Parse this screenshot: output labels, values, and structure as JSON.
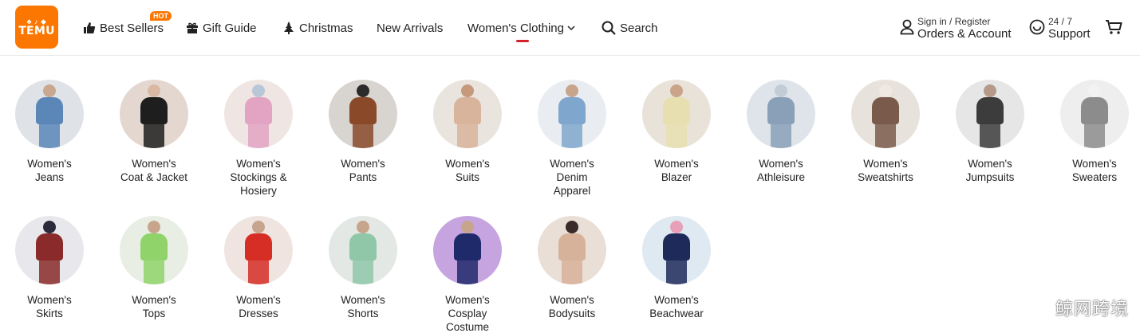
{
  "logo": {
    "glyphs": "♣ ♪ ◆",
    "text": "TEMU"
  },
  "nav": {
    "best_sellers": "Best Sellers",
    "hot_badge": "HOT",
    "gift_guide": "Gift Guide",
    "christmas": "Christmas",
    "new_arrivals": "New Arrivals",
    "womens_clothing": "Women's Clothing",
    "search": "Search"
  },
  "account": {
    "sign_in": "Sign in / Register",
    "orders": "Orders & Account"
  },
  "support": {
    "hours": "24 / 7",
    "label": "Support"
  },
  "icons": [
    "thumbs-up-icon",
    "gift-icon",
    "christmas-tree-icon",
    "chevron-down-icon",
    "search-icon",
    "user-icon",
    "headset-icon",
    "cart-icon"
  ],
  "accent_colors": {
    "brand": "#fb7701",
    "active_underline": "#d4222a"
  },
  "categories": [
    {
      "line1": "Women's",
      "line2": "Jeans",
      "line3": ""
    },
    {
      "line1": "Women's",
      "line2": "Coat & Jacket",
      "line3": ""
    },
    {
      "line1": "Women's",
      "line2": "Stockings &",
      "line3": "Hosiery"
    },
    {
      "line1": "Women's",
      "line2": "Pants",
      "line3": ""
    },
    {
      "line1": "Women's",
      "line2": "Suits",
      "line3": ""
    },
    {
      "line1": "Women's",
      "line2": "Denim",
      "line3": "Apparel"
    },
    {
      "line1": "Women's",
      "line2": "Blazer",
      "line3": ""
    },
    {
      "line1": "Women's",
      "line2": "Athleisure",
      "line3": ""
    },
    {
      "line1": "Women's",
      "line2": "Sweatshirts",
      "line3": ""
    },
    {
      "line1": "Women's",
      "line2": "Jumpsuits",
      "line3": ""
    },
    {
      "line1": "Women's",
      "line2": "Sweaters",
      "line3": ""
    },
    {
      "line1": "Women's",
      "line2": "Skirts",
      "line3": ""
    },
    {
      "line1": "Women's",
      "line2": "Tops",
      "line3": ""
    },
    {
      "line1": "Women's",
      "line2": "Dresses",
      "line3": ""
    },
    {
      "line1": "Women's",
      "line2": "Shorts",
      "line3": ""
    },
    {
      "line1": "Women's",
      "line2": "Cosplay",
      "line3": "Costume"
    },
    {
      "line1": "Women's",
      "line2": "Bodysuits",
      "line3": ""
    },
    {
      "line1": "Women's",
      "line2": "Beachwear",
      "line3": ""
    }
  ],
  "watermark": "鲸网跨境"
}
